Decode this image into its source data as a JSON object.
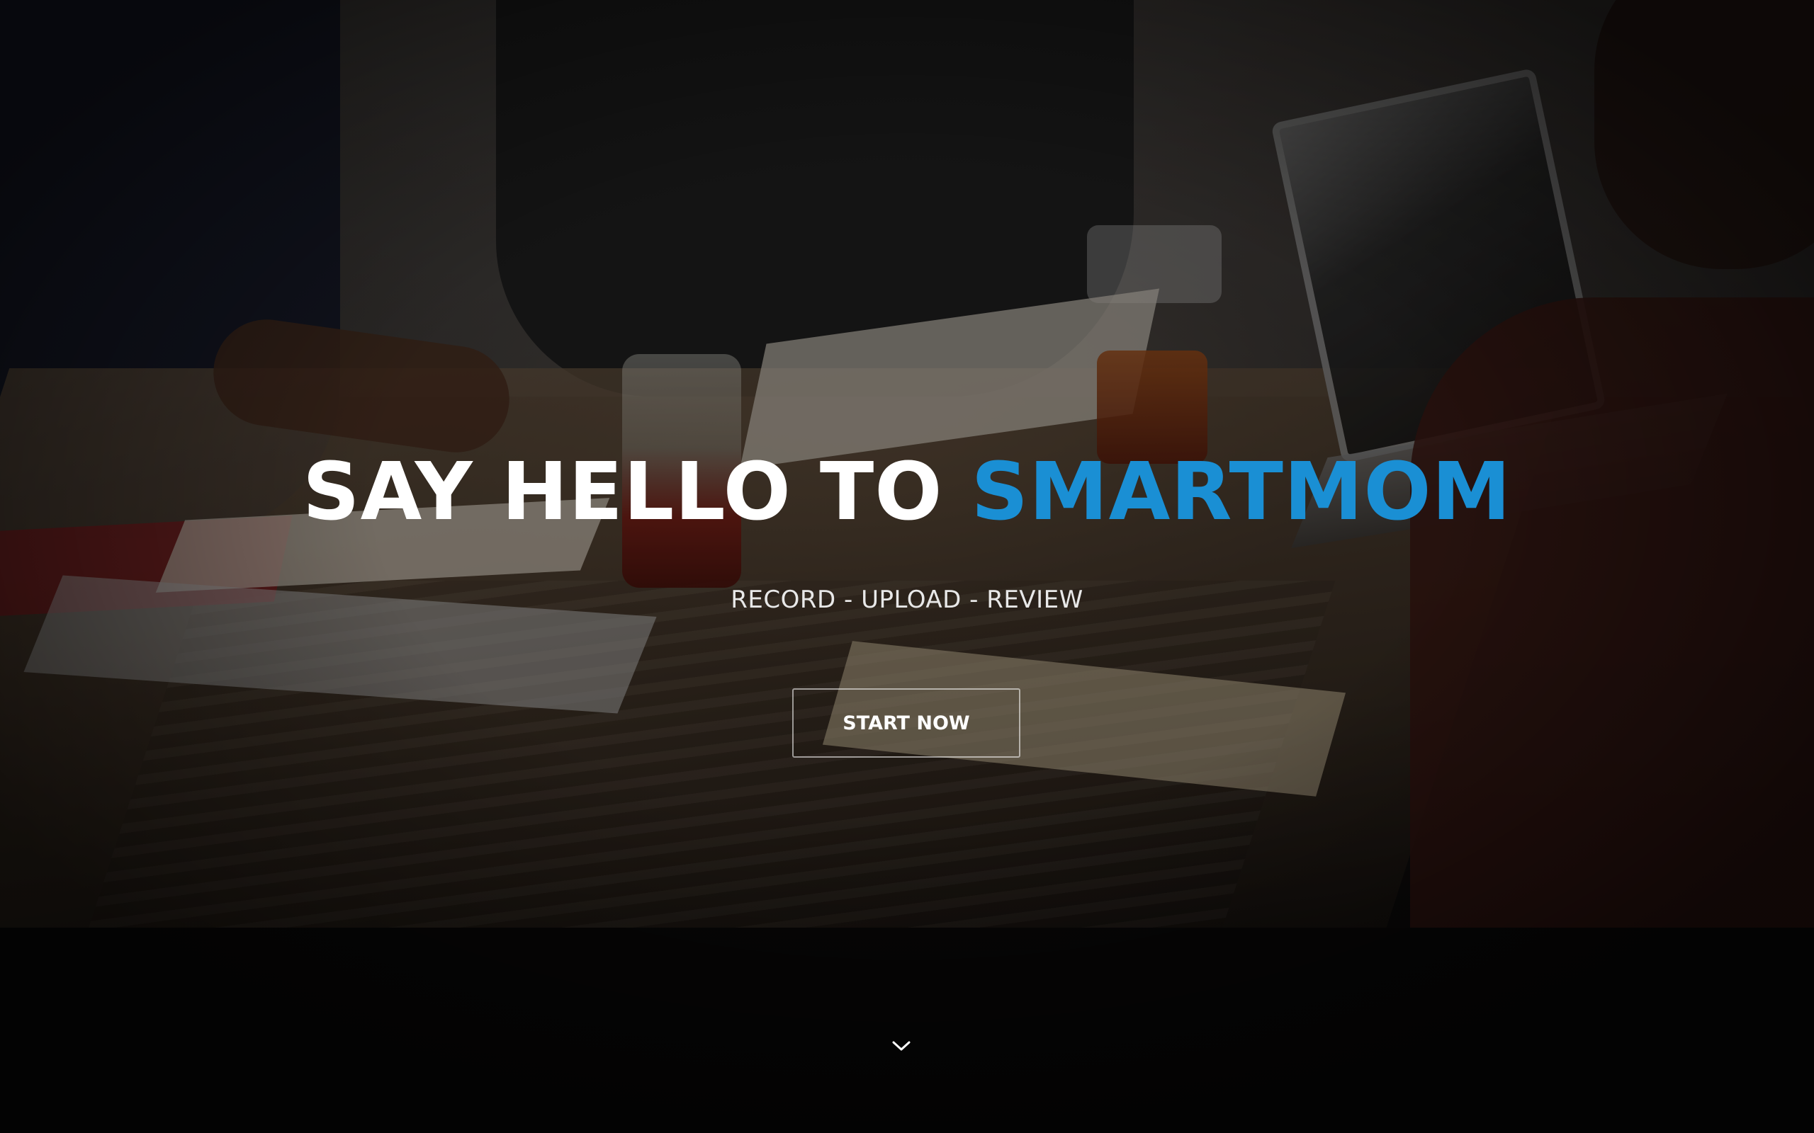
{
  "hero": {
    "headline_prefix": "SAY HELLO TO ",
    "headline_brand": "SMARTMOM",
    "tagline": "RECORD - UPLOAD - REVIEW",
    "cta_label": "START NOW",
    "scroll_icon": "chevron-down-icon"
  },
  "colors": {
    "headline": "#ffffff",
    "brand_accent": "#1a8fd4",
    "overlay": "#000000"
  }
}
